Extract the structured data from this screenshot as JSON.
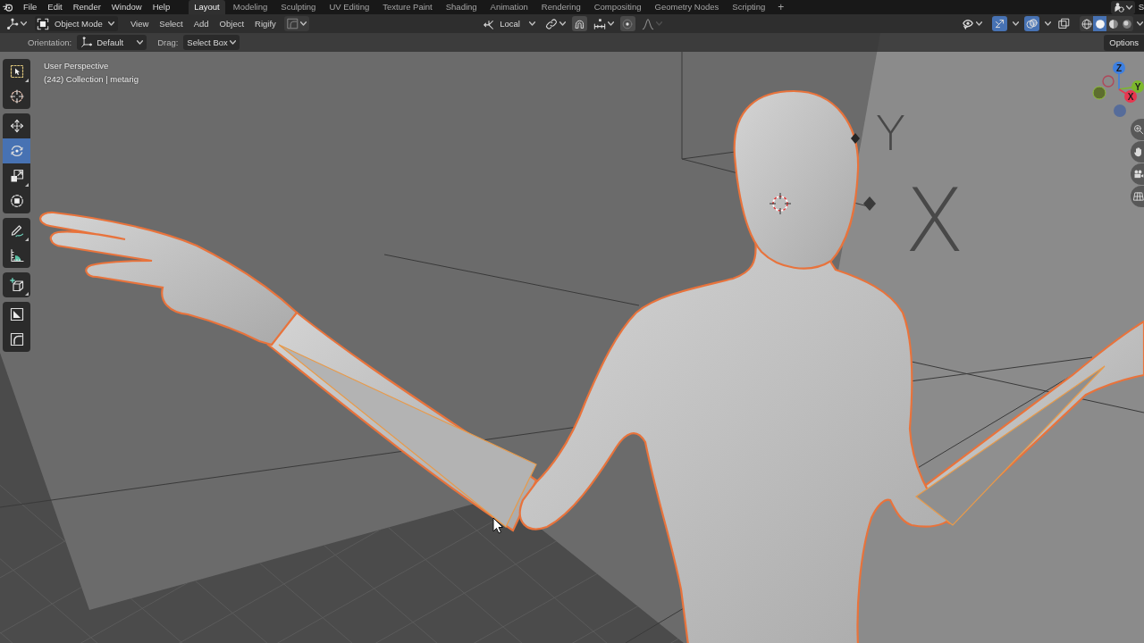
{
  "top_bar": {
    "menus": [
      "File",
      "Edit",
      "Render",
      "Window",
      "Help"
    ],
    "workspaces": [
      {
        "label": "Layout",
        "selected": true
      },
      {
        "label": "Modeling",
        "selected": false
      },
      {
        "label": "Sculpting",
        "selected": false
      },
      {
        "label": "UV Editing",
        "selected": false
      },
      {
        "label": "Texture Paint",
        "selected": false
      },
      {
        "label": "Shading",
        "selected": false
      },
      {
        "label": "Animation",
        "selected": false
      },
      {
        "label": "Rendering",
        "selected": false
      },
      {
        "label": "Compositing",
        "selected": false
      },
      {
        "label": "Geometry Nodes",
        "selected": false
      },
      {
        "label": "Scripting",
        "selected": false
      }
    ],
    "add_workspace": "+",
    "scene_name": "S"
  },
  "header": {
    "mode": "Object Mode",
    "menus": [
      "View",
      "Select",
      "Add",
      "Object",
      "Rigify"
    ],
    "transform_orientation": "Local",
    "snap": {
      "on": false
    },
    "proportional_editing": {
      "on": false
    },
    "falloff": {
      "disabled": true
    },
    "viewport_toggles": [
      {
        "kind": "gizmos",
        "on": true
      },
      {
        "kind": "overlays",
        "on": true
      },
      {
        "kind": "xray",
        "on": false
      }
    ],
    "shading_modes": [
      {
        "kind": "wireframe",
        "selected": false
      },
      {
        "kind": "solid",
        "selected": true
      },
      {
        "kind": "material",
        "selected": false
      },
      {
        "kind": "rendered",
        "selected": false
      }
    ]
  },
  "tool_settings": {
    "orientation_label": "Orientation:",
    "orientation": "Default",
    "drag_label": "Drag:",
    "drag": "Select Box",
    "options": "Options"
  },
  "toolbar": [
    {
      "tools": [
        {
          "kind": "select",
          "selected": false,
          "submenu": true
        },
        {
          "kind": "cursor",
          "selected": false,
          "submenu": false
        }
      ]
    },
    {
      "tools": [
        {
          "kind": "move",
          "selected": false,
          "submenu": false
        },
        {
          "kind": "rotate",
          "selected": true,
          "submenu": false
        },
        {
          "kind": "scale",
          "selected": false,
          "submenu": true
        },
        {
          "kind": "transform",
          "selected": false,
          "submenu": false
        }
      ]
    },
    {
      "tools": [
        {
          "kind": "annotate",
          "selected": false,
          "submenu": true
        },
        {
          "kind": "measure",
          "selected": false,
          "submenu": false
        }
      ]
    },
    {
      "tools": [
        {
          "kind": "add",
          "selected": false,
          "submenu": true
        }
      ]
    },
    {
      "tools": [
        {
          "kind": "slant",
          "selected": false,
          "submenu": false
        },
        {
          "kind": "corner",
          "selected": false,
          "submenu": false
        }
      ]
    }
  ],
  "viewport": {
    "view_name": "User Perspective",
    "collection_info": "(242) Collection | metarig",
    "empty_labels": [
      "Y",
      "X"
    ],
    "gizmo_axes": [
      {
        "label": "Z",
        "color": "#3d7fe0"
      },
      {
        "label": "Y",
        "color": "#7cb82c"
      },
      {
        "label": "X",
        "color": "#e8364f"
      }
    ]
  }
}
